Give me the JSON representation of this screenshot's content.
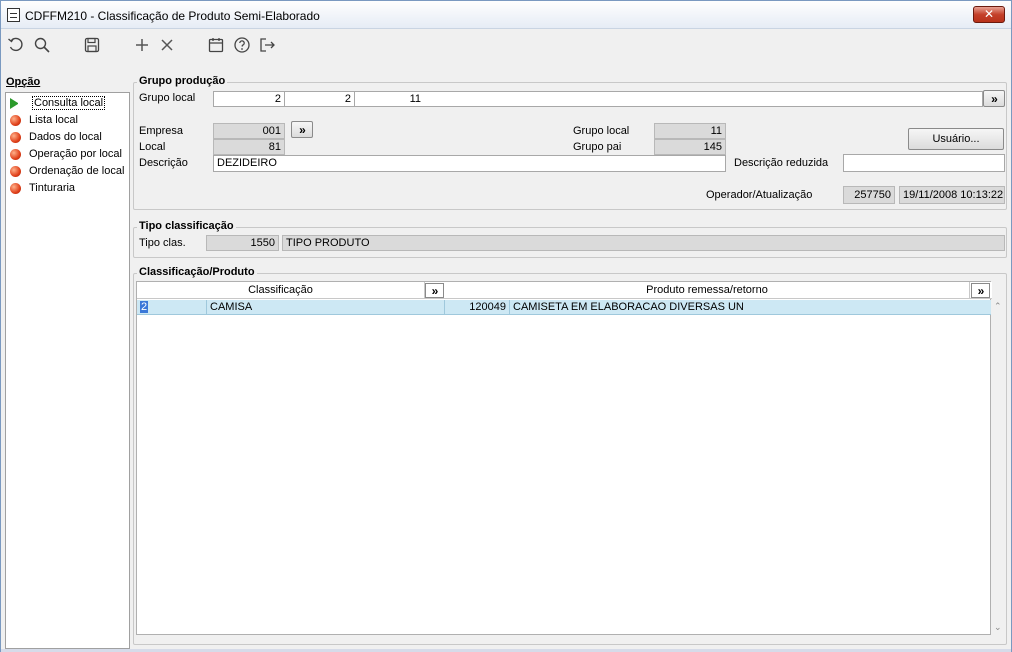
{
  "window": {
    "title": "CDFFM210 - Classificação de Produto Semi-Elaborado",
    "close_label": "✕"
  },
  "toolbar": {
    "icons": [
      "undo-icon",
      "search-icon",
      "save-icon",
      "add-icon",
      "delete-icon",
      "calendar-icon",
      "help-icon",
      "exit-icon"
    ]
  },
  "sidebar": {
    "title": "Opção",
    "items": [
      {
        "label": "Consulta local",
        "active": true
      },
      {
        "label": "Lista local"
      },
      {
        "label": "Dados do local"
      },
      {
        "label": "Operação por local"
      },
      {
        "label": "Ordenação de local"
      },
      {
        "label": "Tinturaria"
      }
    ]
  },
  "grupo_producao": {
    "title": "Grupo produção",
    "grupo_local_label": "Grupo local",
    "grupo_local_1": "2",
    "grupo_local_2": "2",
    "grupo_local_3": "11",
    "empresa_label": "Empresa",
    "empresa": "001",
    "local_label": "Local",
    "local": "81",
    "descricao_label": "Descrição",
    "descricao": "DEZIDEIRO",
    "grupo_local_r_label": "Grupo local",
    "grupo_local_r": "11",
    "grupo_pai_label": "Grupo pai",
    "grupo_pai": "145",
    "usuario_button": "Usuário...",
    "descricao_reduzida_label": "Descrição reduzida",
    "descricao_reduzida": "",
    "operador_label": "Operador/Atualização",
    "operador": "257750",
    "atualizacao": "19/11/2008 10:13:22",
    "lookup_label": "»"
  },
  "tipo_classificacao": {
    "title": "Tipo classificação",
    "tipo_clas_label": "Tipo clas.",
    "tipo_clas_code": "1550",
    "tipo_clas_desc": "TIPO PRODUTO"
  },
  "classificacao_produto": {
    "title": "Classificação/Produto",
    "columns": [
      "Classificação",
      "Produto remessa/retorno"
    ],
    "rows": [
      {
        "code": "2",
        "classificacao": "CAMISA",
        "produto_code": "120049",
        "produto_desc": "CAMISETA EM ELABORACAO DIVERSAS UN"
      }
    ]
  }
}
